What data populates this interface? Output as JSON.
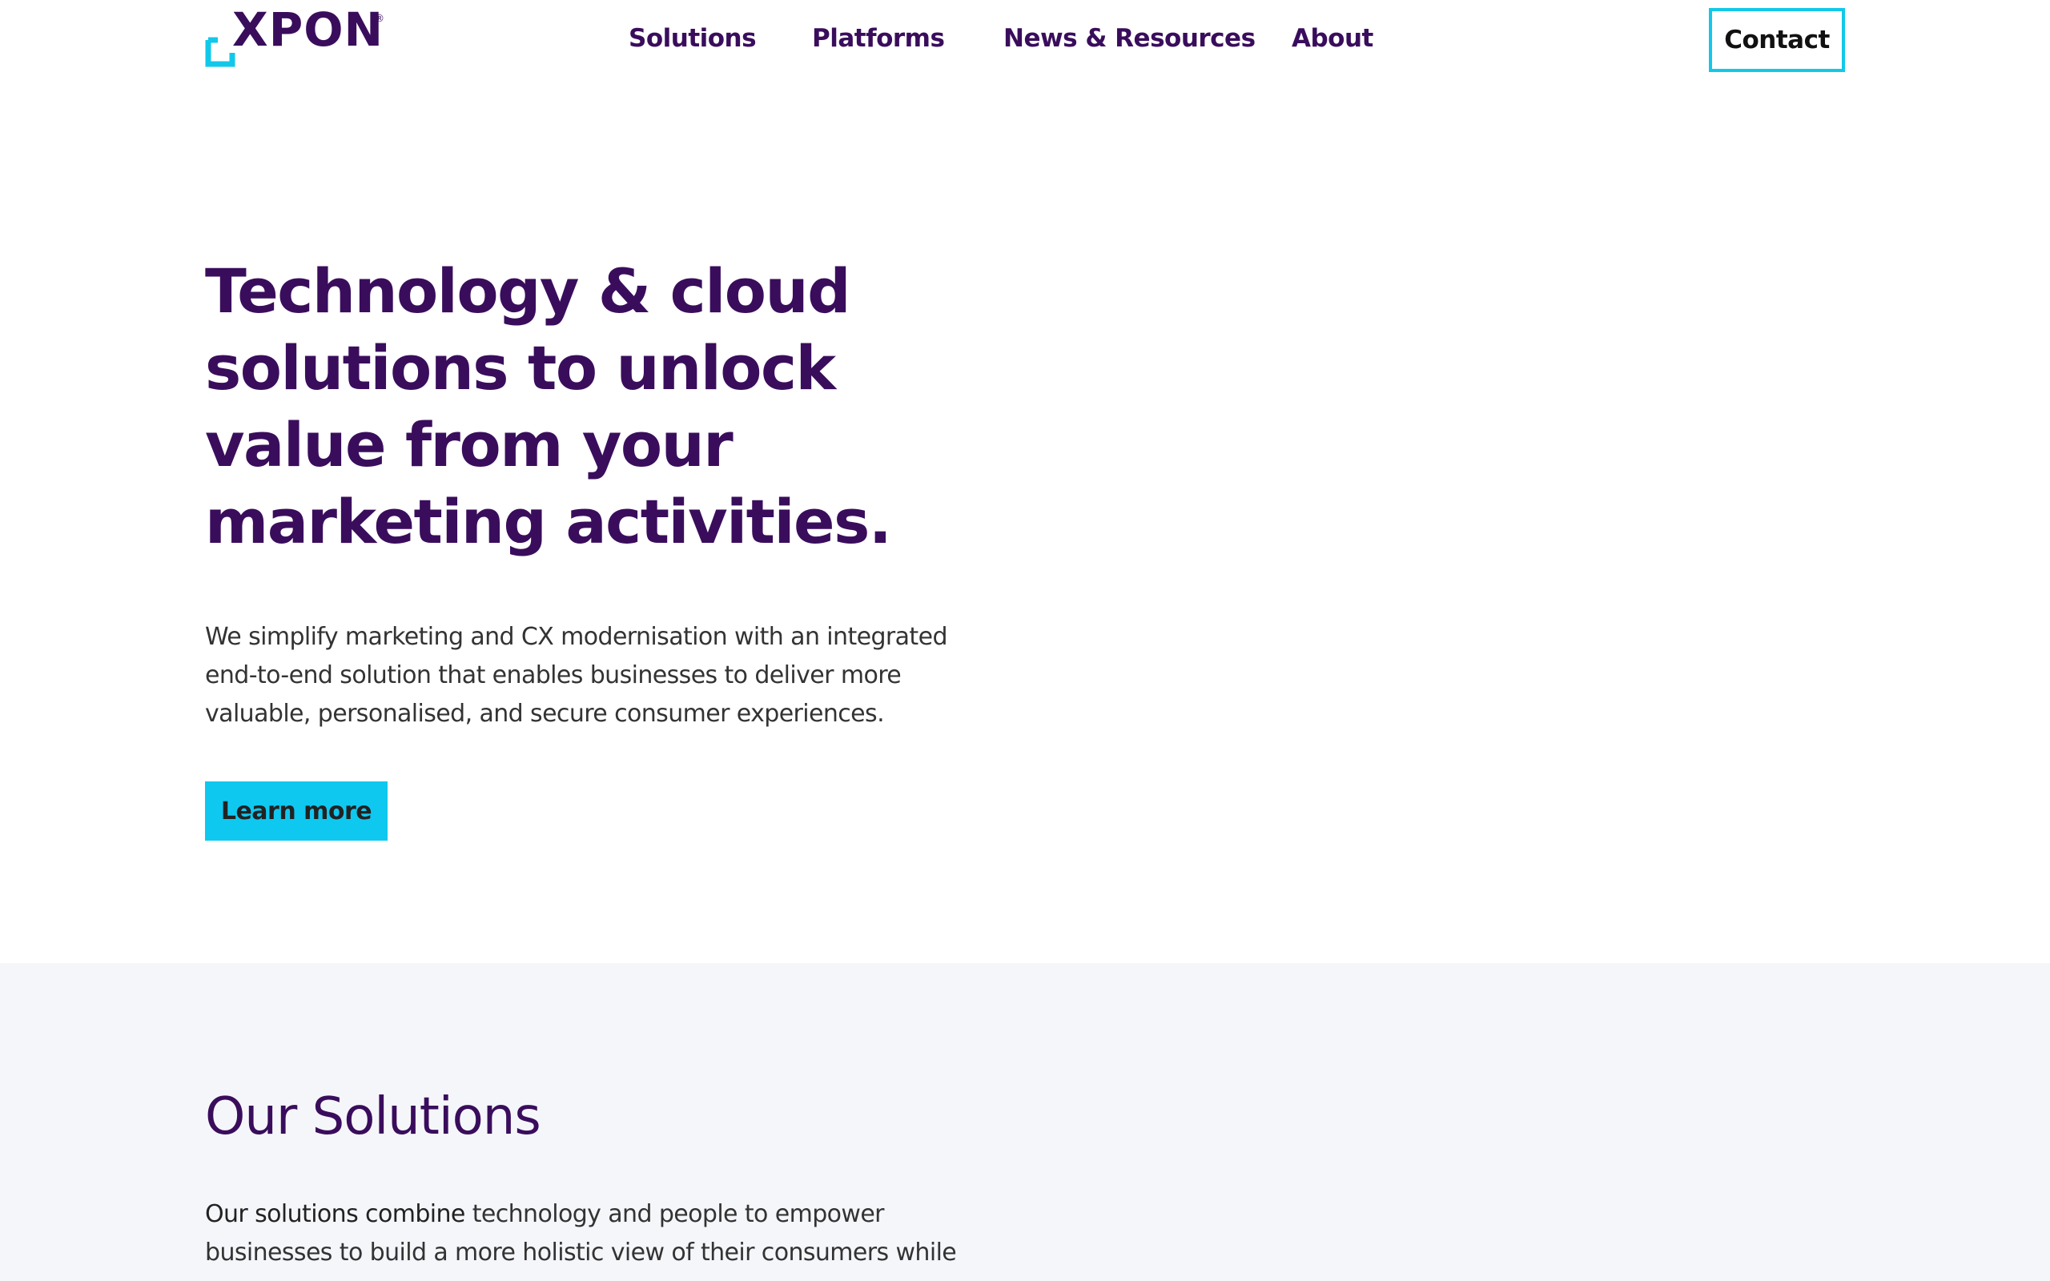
{
  "colors": {
    "brand_purple": "#3a0d5c",
    "accent_cyan": "#0fc8ef",
    "section_bg": "#f5f6fa",
    "body_text": "#333333"
  },
  "header": {
    "logo": {
      "text": "XPON",
      "registered_mark": "®",
      "icon": "xpon-bracket-logo-icon"
    },
    "nav": [
      {
        "label": "Solutions"
      },
      {
        "label": "Platforms"
      },
      {
        "label": "News & Resources"
      },
      {
        "label": "About"
      }
    ],
    "contact_label": "Contact"
  },
  "hero": {
    "title": "Technology & cloud solutions to unlock value from your marketing activities.",
    "text": "We simplify marketing and CX modernisation with an integrated end-to-end solution that enables businesses to deliver more valuable, personalised, and secure consumer experiences.",
    "cta_label": "Learn more"
  },
  "solutions": {
    "title": "Our Solutions",
    "text_lead": "Our solutions combine",
    "text_rest": " technology and people to empower businesses to build a more holistic view of their consumers while"
  }
}
